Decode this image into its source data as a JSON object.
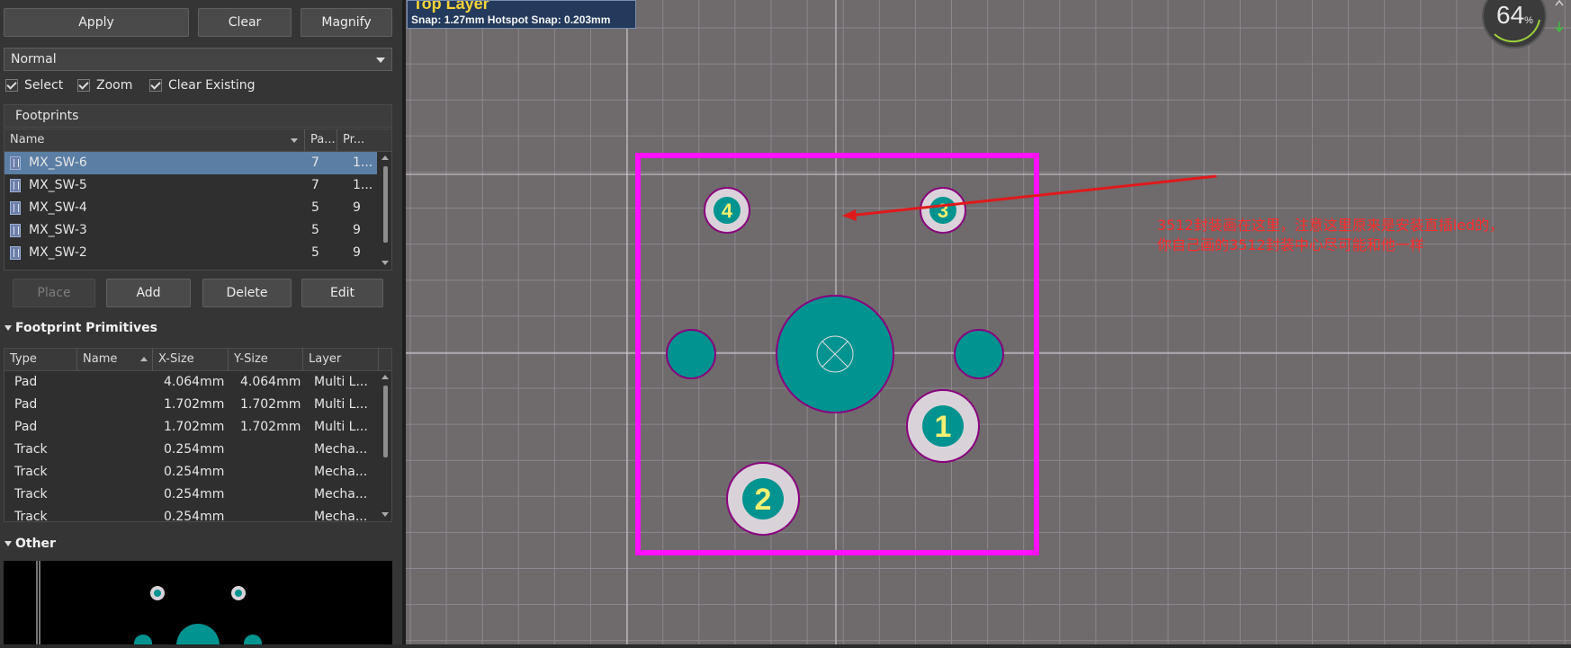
{
  "toolbar": {
    "apply": "Apply",
    "clear": "Clear",
    "magnify": "Magnify"
  },
  "mode_select": {
    "value": "Normal"
  },
  "options": {
    "select": "Select",
    "zoom": "Zoom",
    "clear_existing": "Clear Existing"
  },
  "footprints": {
    "header": "Footprints",
    "columns": [
      "Name",
      "Pa...",
      "Pr..."
    ],
    "rows": [
      {
        "name": "MX_SW-6",
        "pads": "7",
        "prims": "1...",
        "selected": true
      },
      {
        "name": "MX_SW-5",
        "pads": "7",
        "prims": "1..."
      },
      {
        "name": "MX_SW-4",
        "pads": "5",
        "prims": "9"
      },
      {
        "name": "MX_SW-3",
        "pads": "5",
        "prims": "9"
      },
      {
        "name": "MX_SW-2",
        "pads": "5",
        "prims": "9"
      }
    ],
    "buttons": {
      "place": "Place",
      "add": "Add",
      "delete": "Delete",
      "edit": "Edit"
    }
  },
  "primitives": {
    "title": "Footprint Primitives",
    "columns": [
      "Type",
      "Name",
      "X-Size",
      "Y-Size",
      "Layer"
    ],
    "rows": [
      {
        "type": "Pad",
        "name": "",
        "x": "4.064mm",
        "y": "4.064mm",
        "layer": "Multi L..."
      },
      {
        "type": "Pad",
        "name": "",
        "x": "1.702mm",
        "y": "1.702mm",
        "layer": "Multi L..."
      },
      {
        "type": "Pad",
        "name": "",
        "x": "1.702mm",
        "y": "1.702mm",
        "layer": "Multi L..."
      },
      {
        "type": "Track",
        "name": "",
        "x": "0.254mm",
        "y": "",
        "layer": "Mecha..."
      },
      {
        "type": "Track",
        "name": "",
        "x": "0.254mm",
        "y": "",
        "layer": "Mecha..."
      },
      {
        "type": "Track",
        "name": "",
        "x": "0.254mm",
        "y": "",
        "layer": "Mecha..."
      },
      {
        "type": "Track",
        "name": "",
        "x": "0.254mm",
        "y": "",
        "layer": "Mecha..."
      }
    ]
  },
  "other": {
    "title": "Other"
  },
  "layer_info": {
    "layer": "Top Layer",
    "snap": "Snap: 1.27mm Hotspot Snap: 0.203mm"
  },
  "zoom": {
    "value": "64",
    "unit": "%"
  },
  "pads": {
    "p1": "1",
    "p2": "2",
    "p3": "3",
    "p4": "4"
  },
  "annotation": {
    "line1": "3512封装画在这里，注意这里原来是安装直插led的，",
    "line2": "你自己画的3512封装中心尽可能和他一样"
  },
  "colors": {
    "board_bg": "#6f6a6b",
    "grid": "#8c8790",
    "outline": "#ff10ff",
    "pad": "#00938f",
    "pad_ring": "#d9d3d9",
    "pad_edge": "#8a007f",
    "arrow": "#e0191b",
    "label": "#f5f071"
  }
}
